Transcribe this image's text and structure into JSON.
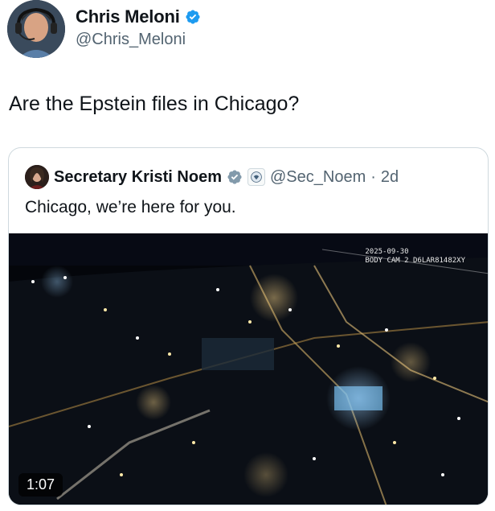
{
  "tweet": {
    "author": {
      "name": "Chris Meloni",
      "handle": "@Chris_Meloni",
      "verified": true
    },
    "text": "Are the Epstein files in Chicago?"
  },
  "quoted_tweet": {
    "author": {
      "name": "Secretary Kristi Noem",
      "handle": "@Sec_Noem",
      "verified": true,
      "government_badge": true
    },
    "separator": "·",
    "time": "2d",
    "text": "Chicago, we’re here for you.",
    "video": {
      "duration": "1:07",
      "overlay_date": "2025-09-30",
      "overlay_cam": "BODY CAM 2 D6LAR81482XY"
    }
  },
  "colors": {
    "verified_blue": "#1d9bf0",
    "text_primary": "#0f1419",
    "text_secondary": "#536471",
    "border": "#cfd9de"
  }
}
